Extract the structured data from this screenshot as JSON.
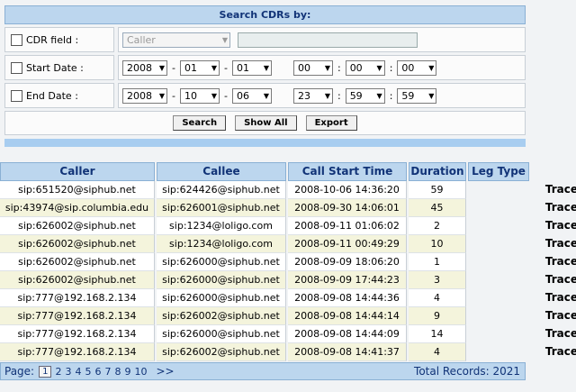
{
  "search": {
    "title": "Search CDRs by:",
    "cdr_field_label": "CDR field :",
    "cdr_field_value": "Caller",
    "start_date_label": "Start Date :",
    "end_date_label": "End Date :",
    "start": {
      "year": "2008",
      "month": "01",
      "day": "01",
      "hour": "00",
      "minute": "00",
      "second": "00"
    },
    "end": {
      "year": "2008",
      "month": "10",
      "day": "06",
      "hour": "23",
      "minute": "59",
      "second": "59"
    },
    "buttons": {
      "search": "Search",
      "show_all": "Show All",
      "export": "Export"
    }
  },
  "table": {
    "headers": {
      "caller": "Caller",
      "callee": "Callee",
      "start_time": "Call Start Time",
      "duration": "Duration",
      "leg_type": "Leg Type"
    },
    "trace_label": "Trace",
    "rows": [
      {
        "caller": "sip:651520@siphub.net",
        "callee": "sip:624426@siphub.net",
        "start_time": "2008-10-06 14:36:20",
        "duration": "59"
      },
      {
        "caller": "sip:43974@sip.columbia.edu",
        "callee": "sip:626001@siphub.net",
        "start_time": "2008-09-30 14:06:01",
        "duration": "45"
      },
      {
        "caller": "sip:626002@siphub.net",
        "callee": "sip:1234@loligo.com",
        "start_time": "2008-09-11 01:06:02",
        "duration": "2"
      },
      {
        "caller": "sip:626002@siphub.net",
        "callee": "sip:1234@loligo.com",
        "start_time": "2008-09-11 00:49:29",
        "duration": "10"
      },
      {
        "caller": "sip:626002@siphub.net",
        "callee": "sip:626000@siphub.net",
        "start_time": "2008-09-09 18:06:20",
        "duration": "1"
      },
      {
        "caller": "sip:626002@siphub.net",
        "callee": "sip:626000@siphub.net",
        "start_time": "2008-09-09 17:44:23",
        "duration": "3"
      },
      {
        "caller": "sip:777@192.168.2.134",
        "callee": "sip:626000@siphub.net",
        "start_time": "2008-09-08 14:44:36",
        "duration": "4"
      },
      {
        "caller": "sip:777@192.168.2.134",
        "callee": "sip:626002@siphub.net",
        "start_time": "2008-09-08 14:44:14",
        "duration": "9"
      },
      {
        "caller": "sip:777@192.168.2.134",
        "callee": "sip:626000@siphub.net",
        "start_time": "2008-09-08 14:44:09",
        "duration": "14"
      },
      {
        "caller": "sip:777@192.168.2.134",
        "callee": "sip:626002@siphub.net",
        "start_time": "2008-09-08 14:41:37",
        "duration": "4"
      }
    ]
  },
  "pager": {
    "label": "Page:",
    "current": "1",
    "pages": [
      "2",
      "3",
      "4",
      "5",
      "6",
      "7",
      "8",
      "9",
      "10"
    ],
    "next": ">>",
    "total": "Total Records: 2021"
  }
}
